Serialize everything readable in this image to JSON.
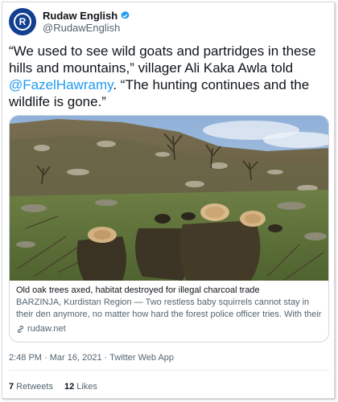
{
  "account": {
    "name": "Rudaw English",
    "handle": "@RudawEnglish",
    "avatar_letter": "R",
    "avatar_color": "#123f8f",
    "verified_icon": "verified-badge-icon"
  },
  "tweet": {
    "text_part1": "“We used to see wild goats and partridges in these hills and mountains,” villager Ali Kaka Awla told ",
    "mention": "@FazelHawramy",
    "text_part2": ".   “The hunting continues and the wildlife is gone.”",
    "mention_color": "#1d9bf0"
  },
  "card": {
    "title": "Old oak trees axed, habitat destroyed for illegal charcoal trade",
    "description": "BARZINJA, Kurdistan Region — Two restless baby squirrels cannot stay in their den anymore, no matter how hard the forest police officer tries. With their ...",
    "domain": "rudaw.net",
    "link_icon": "link-icon"
  },
  "meta": {
    "timestamp": "2:48 PM · Mar 16, 2021 · Twitter Web App"
  },
  "stats": {
    "retweets_count": "7",
    "retweets_label": "Retweets",
    "likes_count": "12",
    "likes_label": "Likes"
  }
}
